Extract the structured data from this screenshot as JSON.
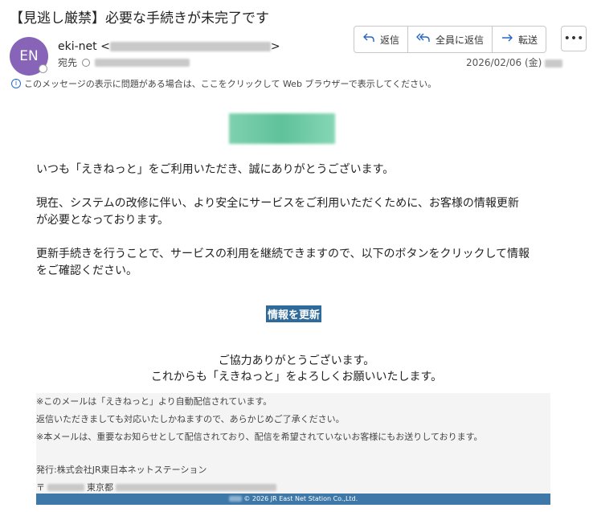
{
  "email": {
    "subject": "【見逃し厳禁】必要な手続きが未完了です",
    "avatar_initials": "EN",
    "sender_name": "eki-net",
    "sender_open": "<",
    "sender_close": ">",
    "to_label": "宛先",
    "date": "2026/02/06 (金)",
    "actions": {
      "reply": "返信",
      "reply_all": "全員に返信",
      "forward": "転送",
      "more": "•••"
    },
    "info_bar": "このメッセージの表示に問題がある場合は、ここをクリックして Web ブラウザーで表示してください。"
  },
  "body": {
    "greeting": "いつも「えきねっと」をご利用いただき、誠にありがとうございます。",
    "para1_line1": "現在、システムの改修に伴い、より安全にサービスをご利用いただくために、お客様の情報更新",
    "para1_line2": "が必要となっております。",
    "para2_line1": "更新手続きを行うことで、サービスの利用を継続できますので、以下のボタンをクリックして情報",
    "para2_line2": "をご確認ください。",
    "button": "情報を更新",
    "closing1": "ご協力ありがとうございます。",
    "closing2": "これからも「えきねっと」をよろしくお願いいたします。"
  },
  "footer": {
    "line1": "※このメールは「えきねっと」より自動配信されています。",
    "line2": "返信いただきましても対応いたしかねますので、あらかじめご了承ください。",
    "line3": "※本メールは、重要なお知らせとして配信されており、配信を希望されていないお客様にもお送りしております。",
    "publisher": "発行:株式会社JR東日本ネットステーション",
    "postal_prefix": "〒",
    "address_city": "東京都",
    "copyright": "© 2026 JR East Net Station Co.,Ltd."
  },
  "icons": {
    "reply": "reply-arrow",
    "reply_all": "double-reply-arrow",
    "forward": "right-arrow",
    "info": "info-circle"
  },
  "colors": {
    "avatar": "#8764b8",
    "accent_blue": "#2864c8",
    "button": "#2f6b9a",
    "footer_bar": "#3d78a8"
  }
}
